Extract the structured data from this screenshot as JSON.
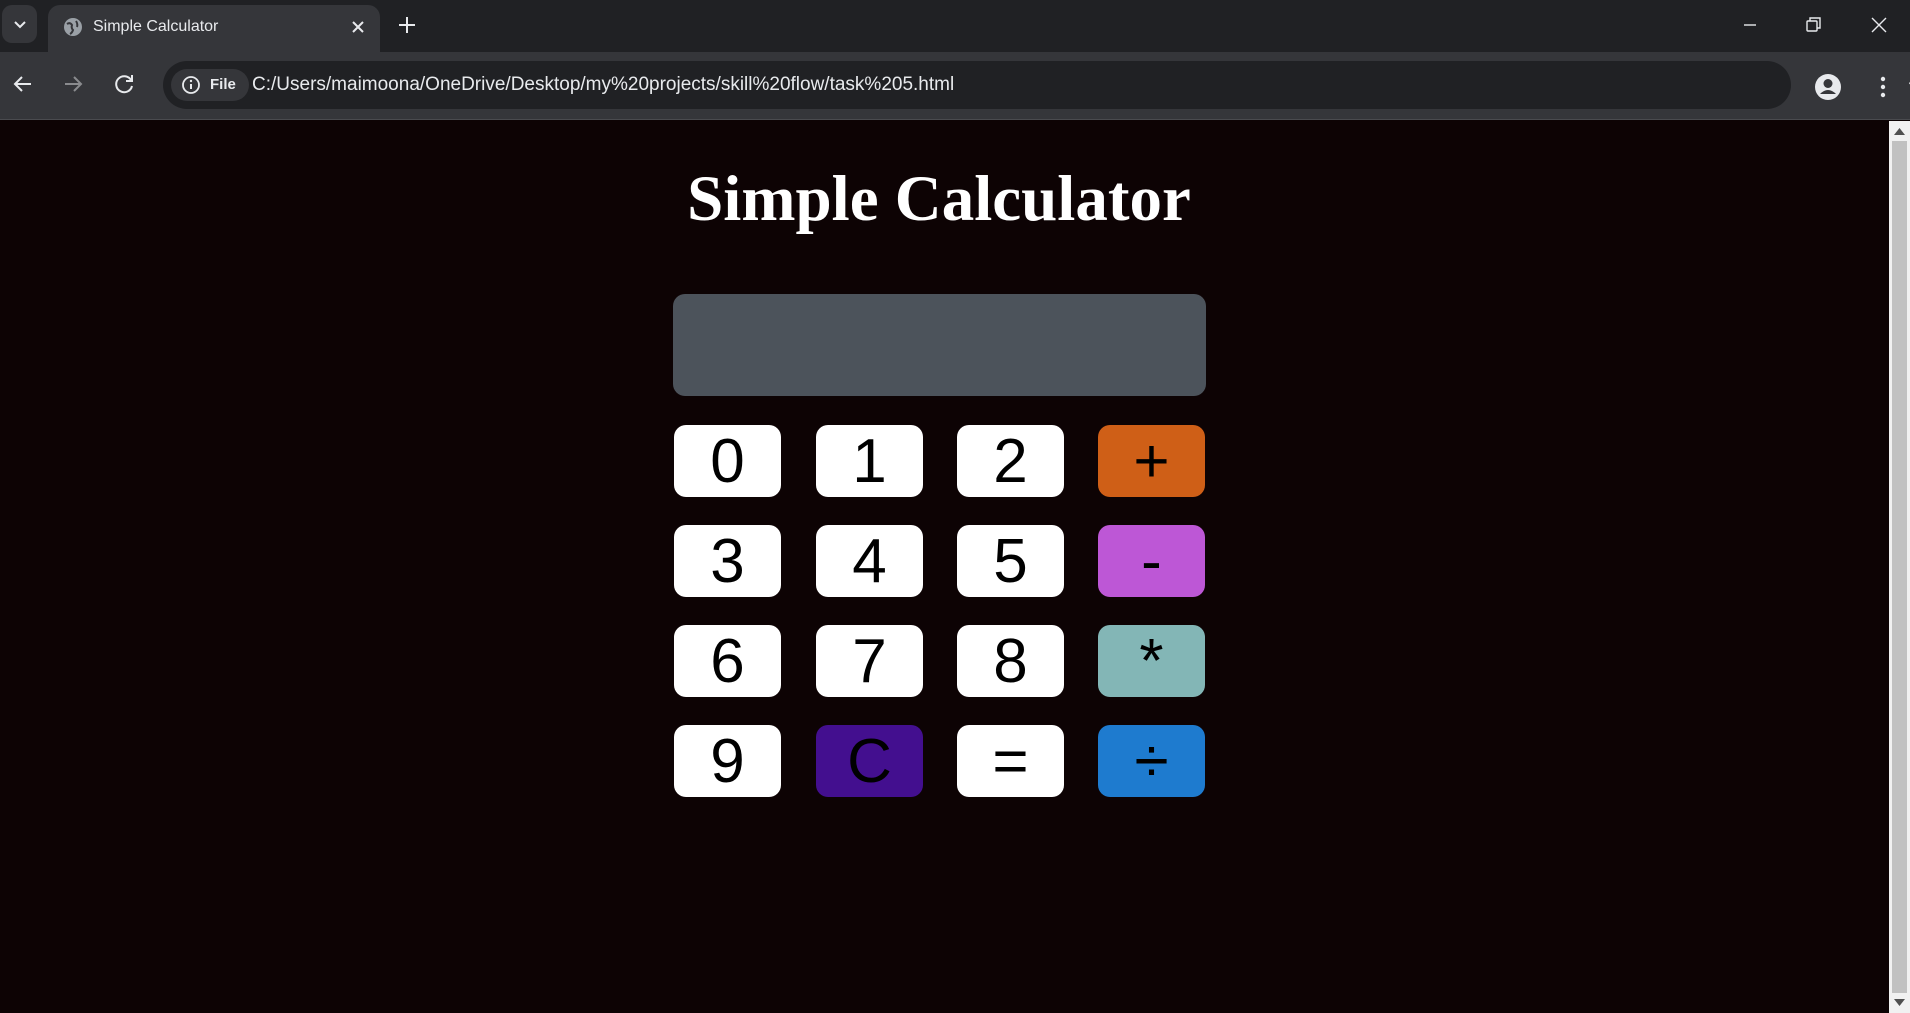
{
  "browser": {
    "tab_title": "Simple Calculator",
    "security_chip_label": "File",
    "url": "C:/Users/maimoona/OneDrive/Desktop/my%20projects/skill%20flow/task%205.html"
  },
  "page": {
    "heading": "Simple Calculator",
    "display_value": ""
  },
  "keys": [
    {
      "label": "0",
      "color": "#ffffff"
    },
    {
      "label": "1",
      "color": "#ffffff"
    },
    {
      "label": "2",
      "color": "#ffffff"
    },
    {
      "label": "+",
      "color": "#cf5f17"
    },
    {
      "label": "3",
      "color": "#ffffff"
    },
    {
      "label": "4",
      "color": "#ffffff"
    },
    {
      "label": "5",
      "color": "#ffffff"
    },
    {
      "label": "-",
      "color": "#bd57d6"
    },
    {
      "label": "6",
      "color": "#ffffff"
    },
    {
      "label": "7",
      "color": "#ffffff"
    },
    {
      "label": "8",
      "color": "#ffffff"
    },
    {
      "label": "*",
      "color": "#83b6b6"
    },
    {
      "label": "9",
      "color": "#ffffff"
    },
    {
      "label": "C",
      "color": "#430f8f"
    },
    {
      "label": "=",
      "color": "#ffffff"
    },
    {
      "label": "÷",
      "color": "#1e7bcf"
    }
  ],
  "colors": {
    "page_background": "#0d0304",
    "display_background": "#4c535b"
  },
  "icons": [
    "tab-search-chevron-icon",
    "globe-favicon-icon",
    "close-icon",
    "plus-icon",
    "minimize-icon",
    "restore-icon",
    "window-close-icon",
    "back-arrow-icon",
    "forward-arrow-icon",
    "reload-icon",
    "info-icon",
    "star-icon",
    "profile-icon",
    "kebab-menu-icon"
  ]
}
